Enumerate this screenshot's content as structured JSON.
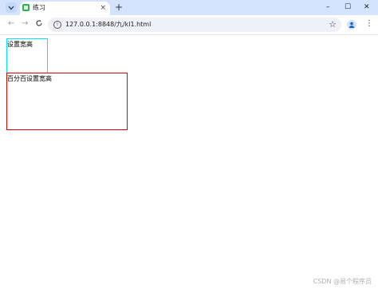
{
  "browser": {
    "tab": {
      "title": "练习",
      "close_glyph": "×"
    },
    "new_tab_glyph": "+",
    "tab_search_glyph": "⌄",
    "window_controls": {
      "minimize": "–",
      "maximize": "☐",
      "close": "✕"
    },
    "nav": {
      "back": "←",
      "forward": "→",
      "reload": "C"
    },
    "omnibox": {
      "url": "127.0.0.1:8848/九/kl1.html"
    },
    "star_glyph": "☆",
    "menu_glyph": "⋮"
  },
  "page": {
    "box1_text": "设置宽高",
    "box2_text": "百分百设置宽高",
    "box1_border_color": "#00e5ff",
    "box2_border_color": "#e00000"
  },
  "watermark": "CSDN @易个程序员"
}
